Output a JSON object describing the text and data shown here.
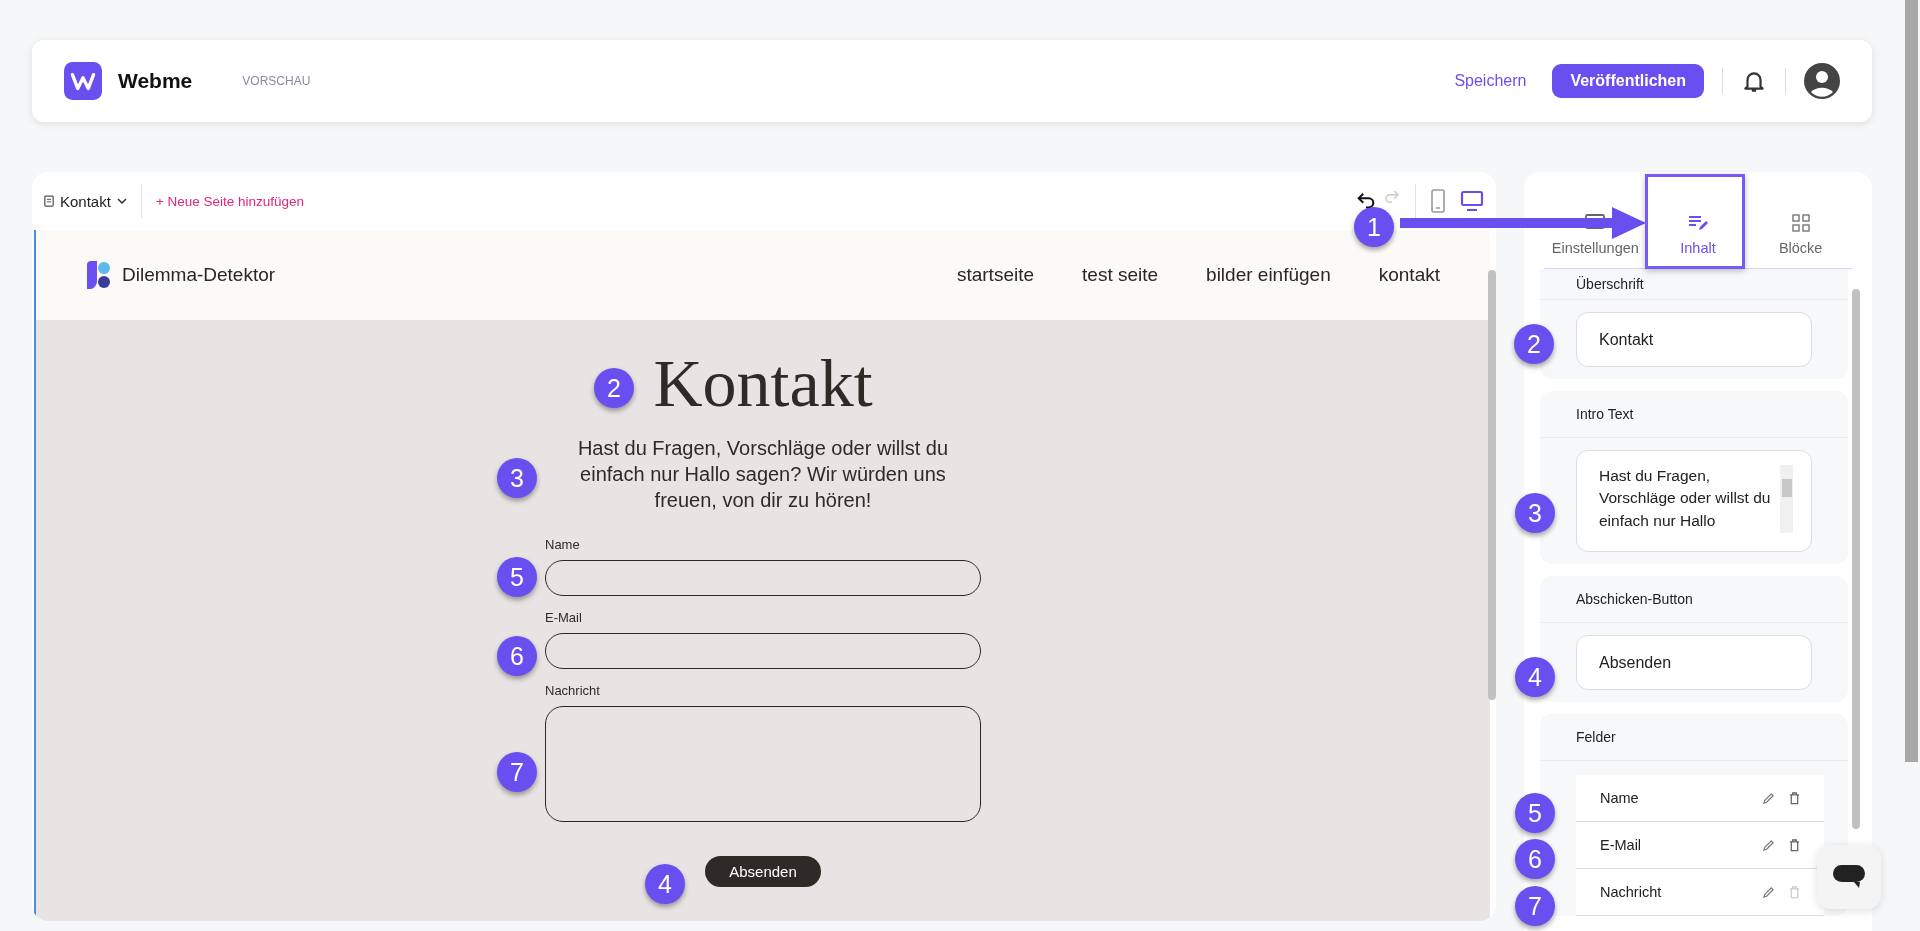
{
  "app_bar": {
    "brand": "Webme",
    "mode": "VORSCHAU",
    "save": "Speichern",
    "publish": "Veröffentlichen"
  },
  "editor_toolbar": {
    "page": "Kontakt",
    "add_page": "+ Neue Seite hinzufügen",
    "devices": [
      {
        "kind": "mobile",
        "selected": false
      },
      {
        "kind": "desktop",
        "selected": true
      }
    ]
  },
  "preview": {
    "site_name": "Dilemma-Detektor",
    "nav": [
      "startseite",
      "test seite",
      "bilder einfügen",
      "kontakt"
    ],
    "heading": "Kontakt",
    "intro": "Hast du Fragen, Vorschläge oder willst du einfach nur Hallo sagen? Wir würden uns freuen, von dir zu hören!",
    "fields": [
      {
        "label": "Name",
        "kind": "line"
      },
      {
        "label": "E-Mail",
        "kind": "line"
      },
      {
        "label": "Nachricht",
        "kind": "area"
      }
    ],
    "submit": "Absenden"
  },
  "panel": {
    "tabs": [
      {
        "label": "Einstellungen",
        "kind": "settings",
        "selected": false
      },
      {
        "label": "Inhalt",
        "kind": "content",
        "selected": true
      },
      {
        "label": "Blöcke",
        "kind": "blocks",
        "selected": false
      }
    ],
    "sections": [
      {
        "title": "Überschrift",
        "kind": "input",
        "value": "Kontakt"
      },
      {
        "title": "Intro Text",
        "kind": "textarea",
        "value": "Hast du Fragen, Vorschläge oder willst du einfach nur Hallo"
      },
      {
        "title": "Abschicken-Button",
        "kind": "input",
        "value": "Absenden"
      },
      {
        "title": "Felder",
        "kind": "list",
        "items": [
          {
            "label": "Name",
            "deletable": true
          },
          {
            "label": "E-Mail",
            "deletable": true
          },
          {
            "label": "Nachricht",
            "deletable": false
          }
        ]
      }
    ]
  },
  "annotations": [
    {
      "number": "1",
      "kind": "arrow"
    },
    {
      "number": "2",
      "kind": "badge"
    },
    {
      "number": "3",
      "kind": "badge"
    },
    {
      "number": "5",
      "kind": "badge"
    },
    {
      "number": "6",
      "kind": "badge"
    },
    {
      "number": "7",
      "kind": "badge"
    },
    {
      "number": "4",
      "kind": "badge"
    },
    {
      "number": "2",
      "kind": "badge"
    },
    {
      "number": "3",
      "kind": "badge"
    },
    {
      "number": "4",
      "kind": "badge"
    },
    {
      "number": "5",
      "kind": "badge"
    },
    {
      "number": "6",
      "kind": "badge"
    },
    {
      "number": "7",
      "kind": "badge"
    }
  ]
}
